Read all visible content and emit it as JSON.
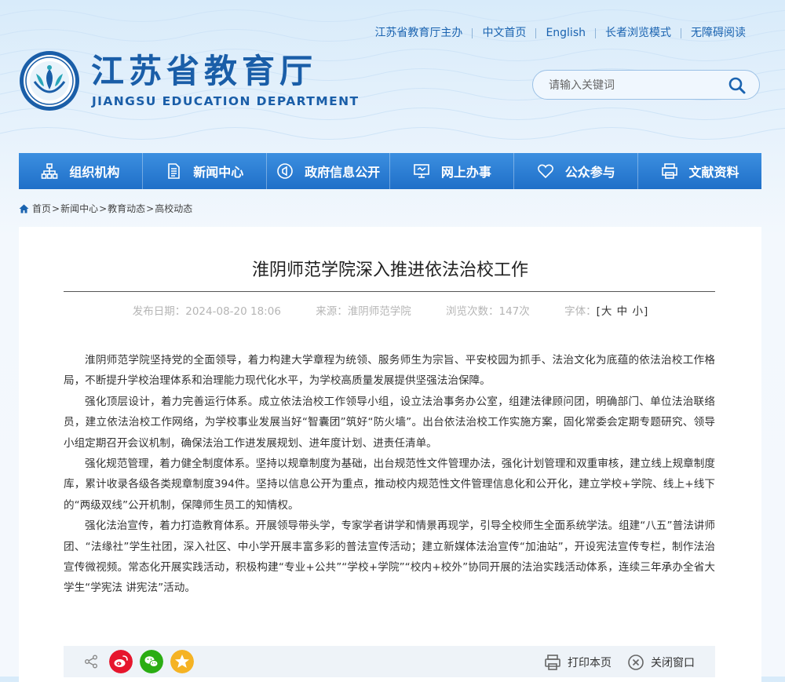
{
  "header": {
    "top_links": [
      "江苏省教育厅主办",
      "中文首页",
      "English",
      "长者浏览模式",
      "无障碍阅读"
    ],
    "title_cn": "江苏省教育厅",
    "title_en": "JIANGSU EDUCATION DEPARTMENT",
    "search_placeholder": "请输入关键词"
  },
  "nav": {
    "items": [
      {
        "label": "组织机构",
        "icon": "org-chart-icon"
      },
      {
        "label": "新闻中心",
        "icon": "document-icon"
      },
      {
        "label": "政府信息公开",
        "icon": "speaker-icon"
      },
      {
        "label": "网上办事",
        "icon": "monitor-icon"
      },
      {
        "label": "公众参与",
        "icon": "heart-icon"
      },
      {
        "label": "文献资料",
        "icon": "printer-icon"
      }
    ]
  },
  "breadcrumb": {
    "items": [
      "首页",
      "新闻中心",
      "教育动态",
      "高校动态"
    ],
    "separator": ">"
  },
  "article": {
    "title": "淮阴师范学院深入推进依法治校工作",
    "publish_date_label": "发布日期：",
    "publish_date": "2024-08-20 18:06",
    "source_label": "来源：",
    "source": "淮阴师范学院",
    "views_label": "浏览次数：",
    "views": "147次",
    "font_label": "字体：",
    "font_open": "[",
    "font_sizes": [
      "大",
      "中",
      "小"
    ],
    "font_close": "]",
    "paragraphs": [
      "淮阴师范学院坚持党的全面领导，着力构建大学章程为统领、服务师生为宗旨、平安校园为抓手、法治文化为底蕴的依法治校工作格局，不断提升学校治理体系和治理能力现代化水平，为学校高质量发展提供坚强法治保障。",
      "强化顶层设计，着力完善运行体系。成立依法治校工作领导小组，设立法治事务办公室，组建法律顾问团，明确部门、单位法治联络员，建立依法治校工作网络，为学校事业发展当好“智囊团”筑好“防火墙”。出台依法治校工作实施方案，固化常委会定期专题研究、领导小组定期召开会议机制，确保法治工作进发展规划、进年度计划、进责任清单。",
      "强化规范管理，着力健全制度体系。坚持以规章制度为基础，出台规范性文件管理办法，强化计划管理和双重审核，建立线上规章制度库，累计收录各级各类规章制度394件。坚持以信息公开为重点，推动校内规范性文件管理信息化和公开化，建立学校+学院、线上+线下的“两级双线”公开机制，保障师生员工的知情权。",
      "强化法治宣传，着力打造教育体系。开展领导带头学，专家学者讲学和情景再现学，引导全校师生全面系统学法。组建“八五”普法讲师团、“法缘社”学生社团，深入社区、中小学开展丰富多彩的普法宣传活动；建立新媒体法治宣传“加油站”，开设宪法宣传专栏，制作法治宣传微视频。常态化开展实践活动，积极构建“专业+公共”“学校+学院”“校内+校外”协同开展的法治实践活动体系，连续三年承办全省大学生“学宪法 讲宪法”活动。"
    ]
  },
  "sharebar": {
    "print_label": "打印本页",
    "close_label": "关闭窗口",
    "colors": {
      "weibo": "#e6162d",
      "wechat": "#2bad13",
      "qzone": "#f5b324"
    }
  }
}
